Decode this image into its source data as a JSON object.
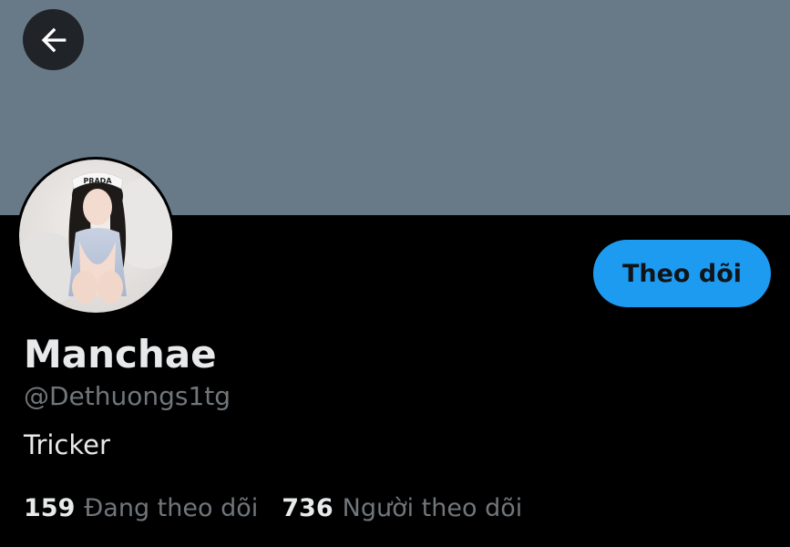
{
  "header": {
    "back_icon": "arrow-left-icon",
    "banner_color": "#687a88"
  },
  "profile": {
    "avatar_text": "PRADA",
    "display_name": "Manchae",
    "username": "@Dethuongs1tg",
    "bio": "Tricker"
  },
  "actions": {
    "follow_label": "Theo dõi",
    "follow_color": "#1d9bf0"
  },
  "stats": {
    "following_count": "159",
    "following_label": "Đang theo dõi",
    "followers_count": "736",
    "followers_label": "Người theo dõi"
  }
}
